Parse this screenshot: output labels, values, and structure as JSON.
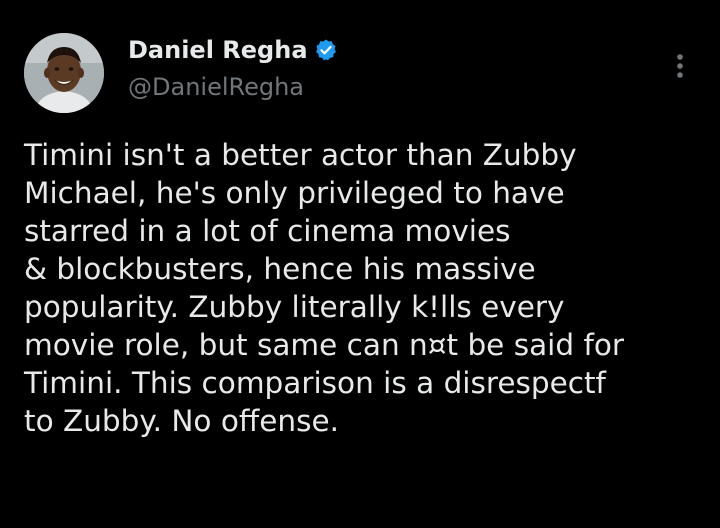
{
  "author": {
    "display_name": "Daniel Regha",
    "handle": "@DanielRegha",
    "verified": true,
    "avatar_icon": "profile-photo",
    "verified_color": "#1d9bf0"
  },
  "menu": {
    "icon": "more-vertical-icon"
  },
  "tweet": {
    "lines": [
      "Timini isn't a better actor than Zubby",
      "Michael, he's only privileged to have",
      "starred in a lot of cinema movies",
      "& blockbusters, hence his massive",
      "popularity. Zubby literally k!lls every",
      "movie role, but same can n¤t be said for",
      "Timini. This comparison is a disrespectf",
      "to Zubby. No offense."
    ]
  },
  "colors": {
    "background": "#000000",
    "text_primary": "#e7e9ea",
    "text_secondary": "#71767b"
  }
}
